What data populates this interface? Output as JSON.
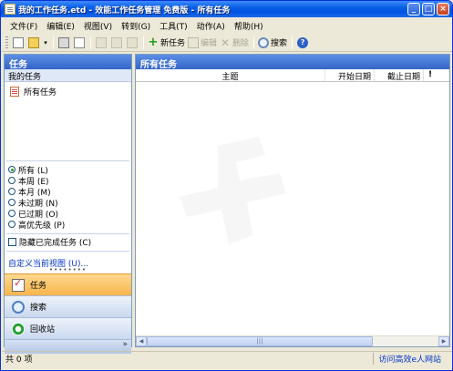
{
  "window": {
    "title": "我的工作任务.etd - 效能工作任务管理 免费版 - 所有任务",
    "controls": {
      "minimize": "_",
      "maximize": "□",
      "close": "×"
    }
  },
  "menu": [
    "文件(F)",
    "编辑(E)",
    "视图(V)",
    "转到(G)",
    "工具(T)",
    "动作(A)",
    "帮助(H)"
  ],
  "toolbar": {
    "new_task": "新任务",
    "edit": "编辑",
    "delete": "删除",
    "search": "搜索",
    "help_glyph": "?"
  },
  "nav": {
    "header": "任务",
    "section": "我的任务",
    "all_tasks": "所有任务",
    "filters": [
      {
        "label": "所有 (L)",
        "checked": true
      },
      {
        "label": "本周 (E)",
        "checked": false
      },
      {
        "label": "本月 (M)",
        "checked": false
      },
      {
        "label": "未过期 (N)",
        "checked": false
      },
      {
        "label": "已过期 (O)",
        "checked": false
      },
      {
        "label": "高优先级 (P)",
        "checked": false
      }
    ],
    "hide_completed": "隐藏已完成任务 (C)",
    "custom_view": "自定义当前视图 (U)...",
    "splitter": "••••••••",
    "buttons": [
      {
        "label": "任务",
        "icon": "task-icon",
        "active": true
      },
      {
        "label": "搜索",
        "icon": "search-icon",
        "active": false
      },
      {
        "label": "回收站",
        "icon": "recycle-icon",
        "active": false
      }
    ],
    "footer_glyph": "»"
  },
  "main": {
    "header": "所有任务",
    "columns": {
      "subject": "主题",
      "start_date": "开始日期",
      "due_date": "截止日期",
      "flag": "!"
    },
    "scroll_grip": "|||"
  },
  "status": {
    "count": "共 0 项",
    "link": "访问高效e人网站"
  },
  "colors": {
    "titlebar": "#0054e3",
    "pane_header": "#3465c8",
    "active_nav": "#f8b54a",
    "link": "#0033cc"
  }
}
